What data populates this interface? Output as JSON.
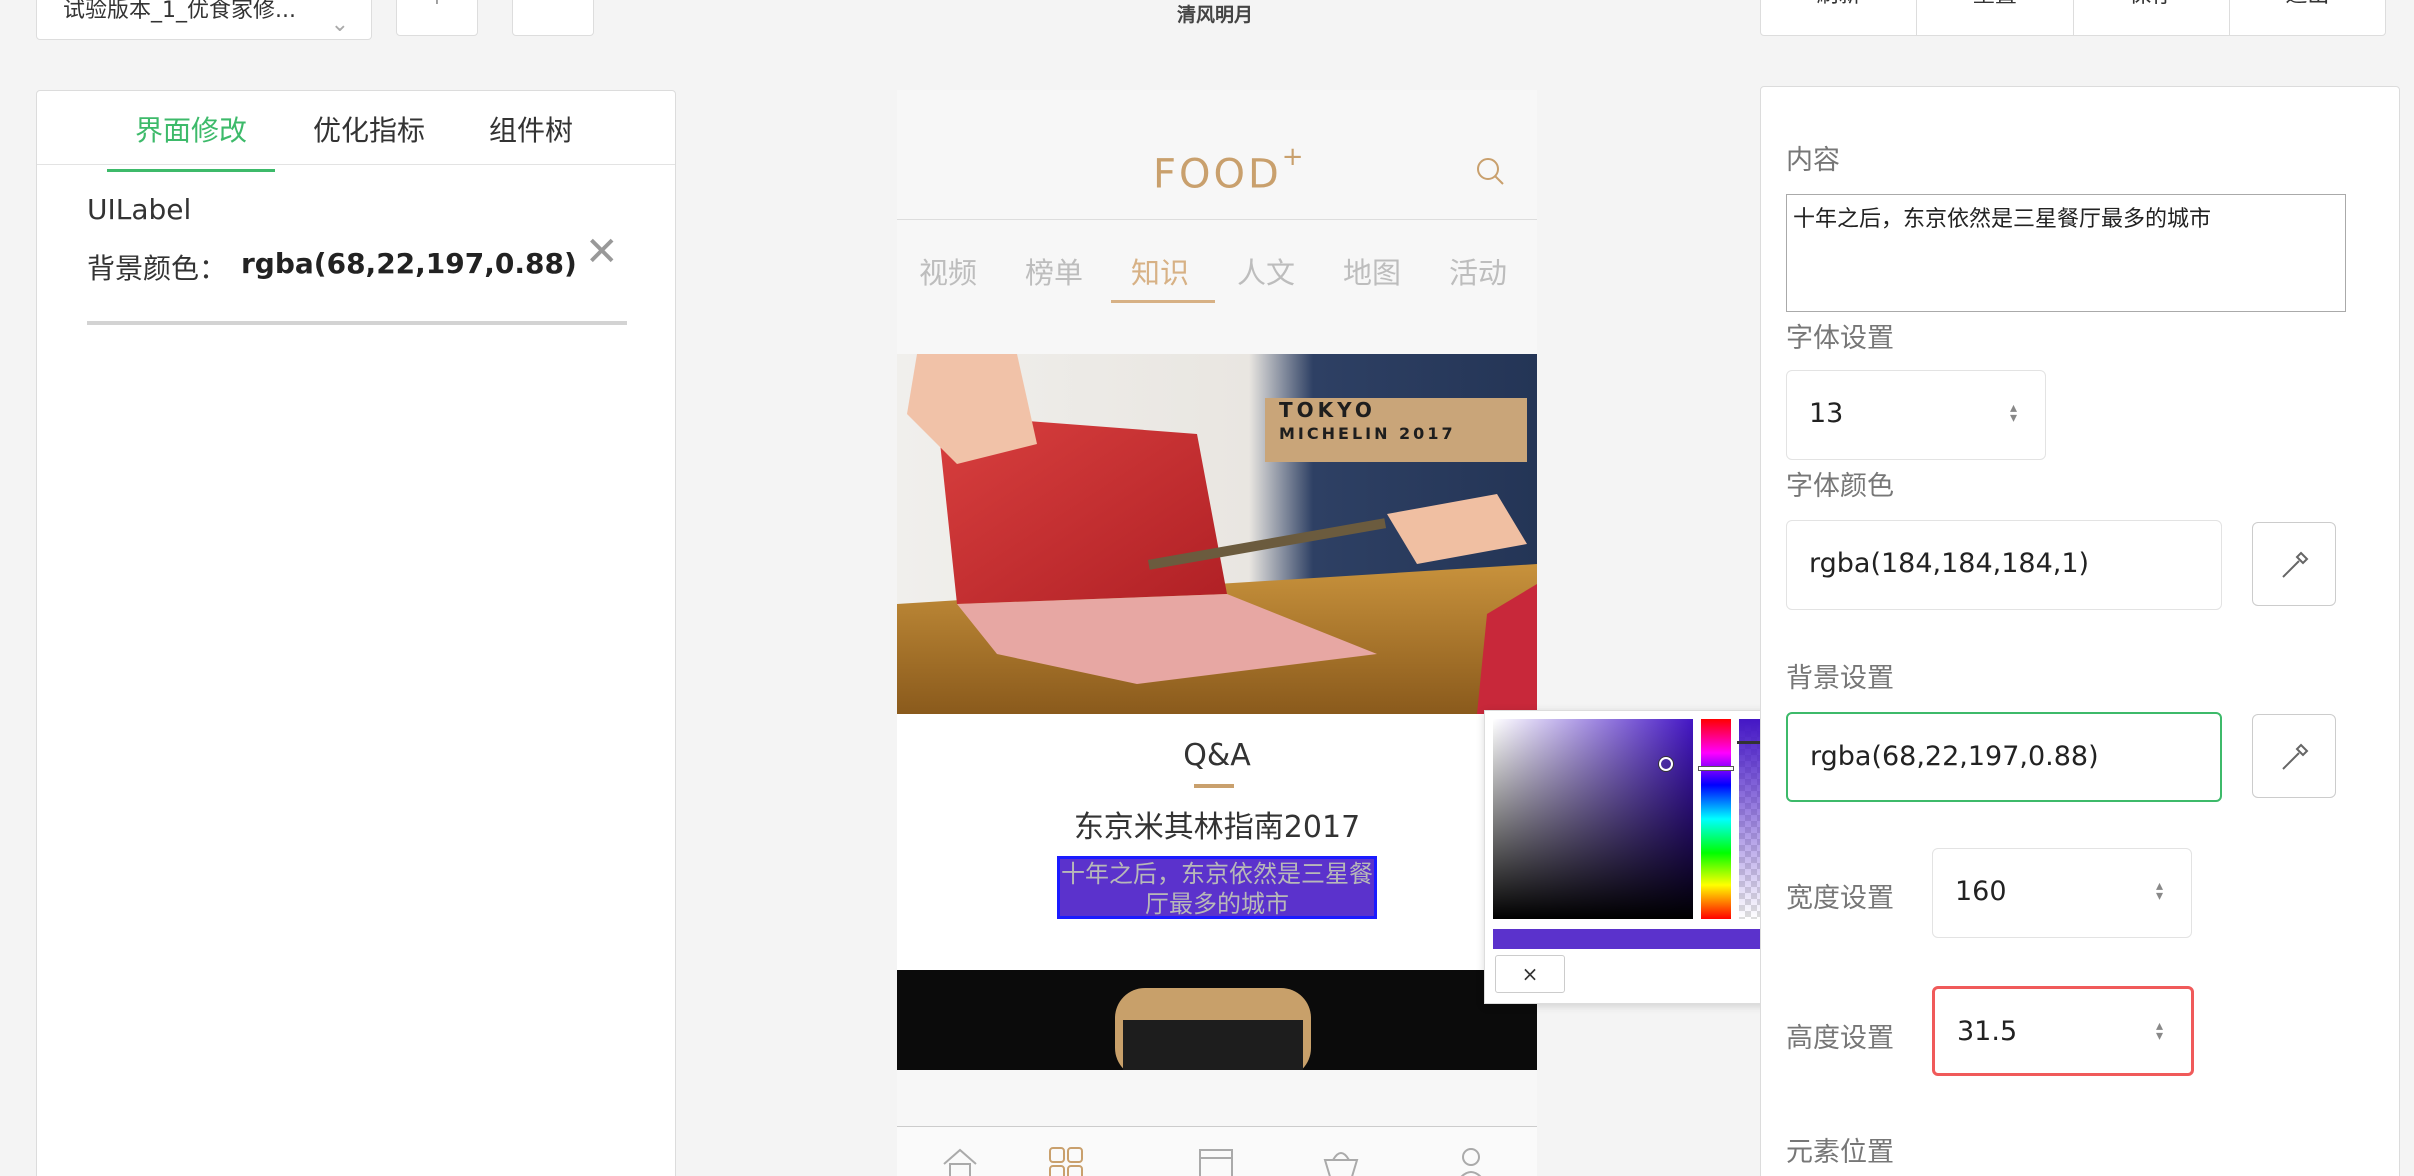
{
  "toolbar": {
    "version_select": "试验版本_1_优食家修...",
    "add_glyph": "+",
    "delete_glyph": "🗑",
    "page_name": "清风明月",
    "actions": [
      "刷新",
      "重置",
      "保存",
      "退出"
    ]
  },
  "left_panel": {
    "tabs": [
      "界面修改",
      "优化指标",
      "组件树"
    ],
    "active_tab": "界面修改",
    "element_type": "UILabel",
    "bg_label": "背景颜色：",
    "bg_value": "rgba(68,22,197,0.88)",
    "close_glyph": "✕"
  },
  "phone": {
    "logo": "FOOD",
    "logo_sup": "+",
    "nav": [
      "视频",
      "榜单",
      "知识",
      "人文",
      "地图",
      "活动"
    ],
    "active_nav": "知识",
    "hero_badge_line1": "TOKYO",
    "hero_badge_line2": "MICHELIN 2017",
    "card_heading": "Q&A",
    "card_title": "东京米其林指南2017",
    "selected_label_text": "十年之后，东京依然是三星餐厅最多的城市",
    "colors": {
      "accent": "#c9a06d",
      "label_bg": "rgba(68,22,197,0.88)"
    }
  },
  "color_picker": {
    "clear_label": "×",
    "current": "#4416c5",
    "alpha": 0.88
  },
  "right_panel": {
    "content_label": "内容",
    "content_value": "十年之后，东京依然是三星餐厅最多的城市",
    "font_size_label": "字体设置",
    "font_size_value": "13",
    "font_color_label": "字体颜色",
    "font_color_value": "rgba(184,184,184,1)",
    "bg_label": "背景设置",
    "bg_value": "rgba(68,22,197,0.88)",
    "width_label": "宽度设置",
    "width_value": "160",
    "height_label": "高度设置",
    "height_value": "31.5",
    "position_label": "元素位置"
  }
}
